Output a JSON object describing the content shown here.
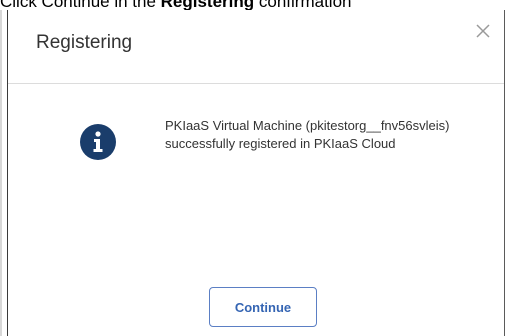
{
  "document": {
    "instruction_prefix": "Click Continue in the ",
    "instruction_bold": "Registering",
    "instruction_suffix": " confirmation"
  },
  "dialog": {
    "title": "Registering",
    "close_icon": "close-icon",
    "info_icon": "info-icon",
    "message": "PKIaaS Virtual Machine (pkitestorg__fnv56svleis) successfully registered in PKIaaS Cloud",
    "continue_label": "Continue"
  },
  "colors": {
    "info_icon_fill": "#1a3d6b",
    "button_border": "#5b7fc4",
    "button_text": "#3565b3",
    "title_text": "#333333",
    "close_icon": "#9a9a9a"
  }
}
